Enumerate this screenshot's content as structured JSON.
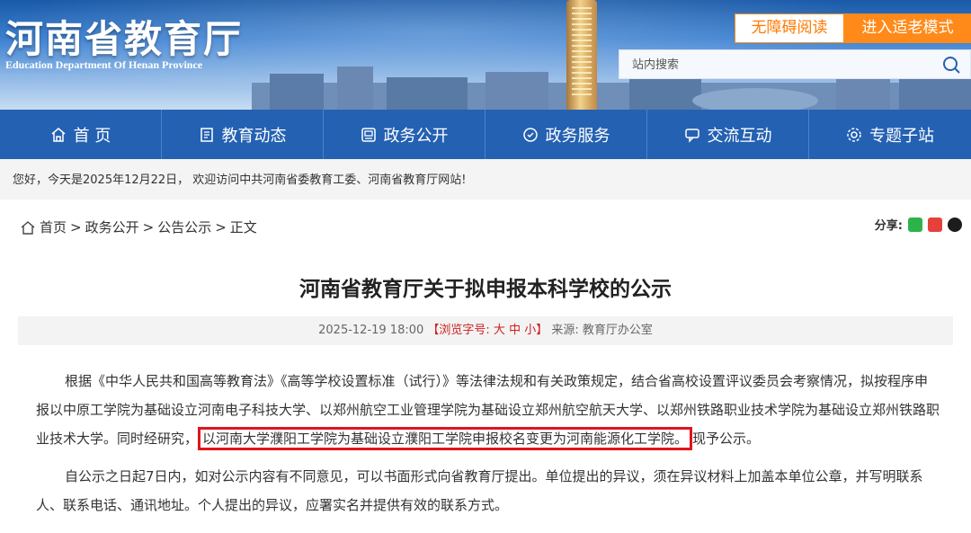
{
  "header": {
    "title": "河南省教育厅",
    "subtitle": "Education Department Of Henan Province",
    "accessibility_button": "无障碍阅读",
    "elder_mode_button": "进入适老模式",
    "search_placeholder": "站内搜索"
  },
  "nav": {
    "items": [
      {
        "label": "首 页",
        "icon": "home-icon"
      },
      {
        "label": "教育动态",
        "icon": "news-icon"
      },
      {
        "label": "政务公开",
        "icon": "document-icon"
      },
      {
        "label": "政务服务",
        "icon": "service-icon"
      },
      {
        "label": "交流互动",
        "icon": "chat-icon"
      },
      {
        "label": "专题子站",
        "icon": "gear-icon"
      }
    ]
  },
  "welcome": "您好，今天是2025年12月22日，  欢迎访问中共河南省委教育工委、河南省教育厅网站!",
  "breadcrumb": {
    "home": "首页",
    "level1": "政务公开",
    "level2": "公告公示",
    "current": "正文",
    "separator": ">"
  },
  "share": {
    "label": "分享:",
    "icons": [
      "wechat-icon",
      "weibo-icon",
      "qq-icon"
    ]
  },
  "article": {
    "title": "河南省教育厅关于拟申报本科学校的公示",
    "date": "2025-12-19 18:00",
    "font_size_label": "【浏览字号: 大 中 小】",
    "source": "来源: 教育厅办公室",
    "p1_before": "根据《中华人民共和国高等教育法》《高等学校设置标准（试行）》等法律法规和有关政策规定，结合省高校设置评议委员会考察情况，拟按程序申报以中原工学院为基础设立河南电子科技大学、以郑州航空工业管理学院为基础设立郑州航空航天大学、以郑州铁路职业技术学院为基础设立郑州铁路职业技术大学。同时经研究，",
    "p1_highlight": "以河南大学濮阳工学院为基础设立濮阳工学院申报校名变更为河南能源化工学院。",
    "p1_after": "现予公示。",
    "p2": "自公示之日起7日内，如对公示内容有不同意见，可以书面形式向省教育厅提出。单位提出的异议，须在异议材料上加盖本单位公章，并写明联系人、联系电话、通讯地址。个人提出的异议，应署实名并提供有效的联系方式。"
  },
  "colors": {
    "nav_bg": "#2461b2",
    "accent_orange": "#ff8a1a",
    "highlight_red": "#e0141c"
  }
}
